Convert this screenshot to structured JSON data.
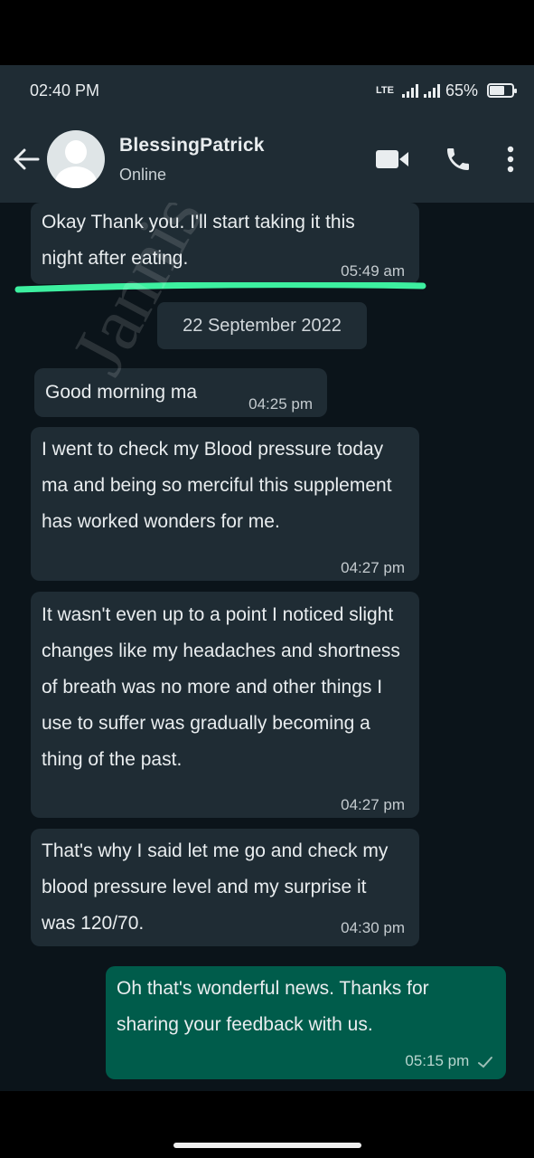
{
  "status_bar": {
    "time": "02:40 PM",
    "network": "LTE",
    "battery": "65%",
    "battery_level": 0.65
  },
  "header": {
    "contact_name": "BlessingPatrick",
    "contact_status": "Online",
    "icons": [
      "back-arrow-icon",
      "video-call-icon",
      "voice-call-icon",
      "more-options-icon"
    ]
  },
  "messages": [
    {
      "direction": "in",
      "text": "Okay Thank you. I'll start taking it this night after eating.",
      "time": "05:49 am"
    },
    {
      "direction": "in",
      "text": "Good morning ma",
      "time": "04:25 pm"
    },
    {
      "direction": "in",
      "text": "I went to check my Blood pressure today ma and being so merciful this supplement has worked wonders for me.",
      "time": "04:27 pm"
    },
    {
      "direction": "in",
      "text": "It wasn't even up to a point I noticed slight changes like my headaches and shortness of breath was no more and other things I use to suffer was gradually becoming a thing of the past.",
      "time": "04:27 pm"
    },
    {
      "direction": "in",
      "text": "That's why I said let me go and check my blood pressure level and my surprise it was 120/70.",
      "time": "04:30 pm"
    },
    {
      "direction": "out",
      "text": "Oh that's wonderful news. Thanks for sharing your feedback with us.",
      "time": "05:15 pm",
      "read_status": "sent-check"
    }
  ],
  "date_separator": "22 September 2022",
  "watermark": "Jannis Healthcare",
  "colors": {
    "header_bg": "#1f2c34",
    "chat_bg": "#0b141a",
    "incoming_bubble": "#1f2c34",
    "outgoing_bubble": "#005c4b",
    "highlight_line": "#3df0a0"
  }
}
